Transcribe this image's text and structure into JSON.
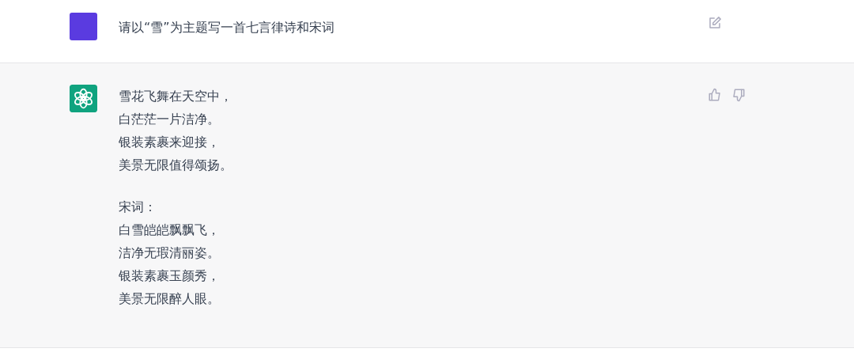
{
  "messages": [
    {
      "kind": "user",
      "text": "请以“雪”为主题写一首七言律诗和宋词"
    },
    {
      "kind": "assistant",
      "paragraphs": [
        [
          "雪花飞舞在天空中，",
          "白茫茫一片洁净。",
          "银装素裹来迎接，",
          "美景无限值得颂扬。"
        ],
        [
          "宋词：",
          "白雪皑皑飘飘飞，",
          "洁净无瑕清丽姿。",
          "银装素裹玉颜秀，",
          "美景无限醉人眼。"
        ]
      ]
    }
  ]
}
